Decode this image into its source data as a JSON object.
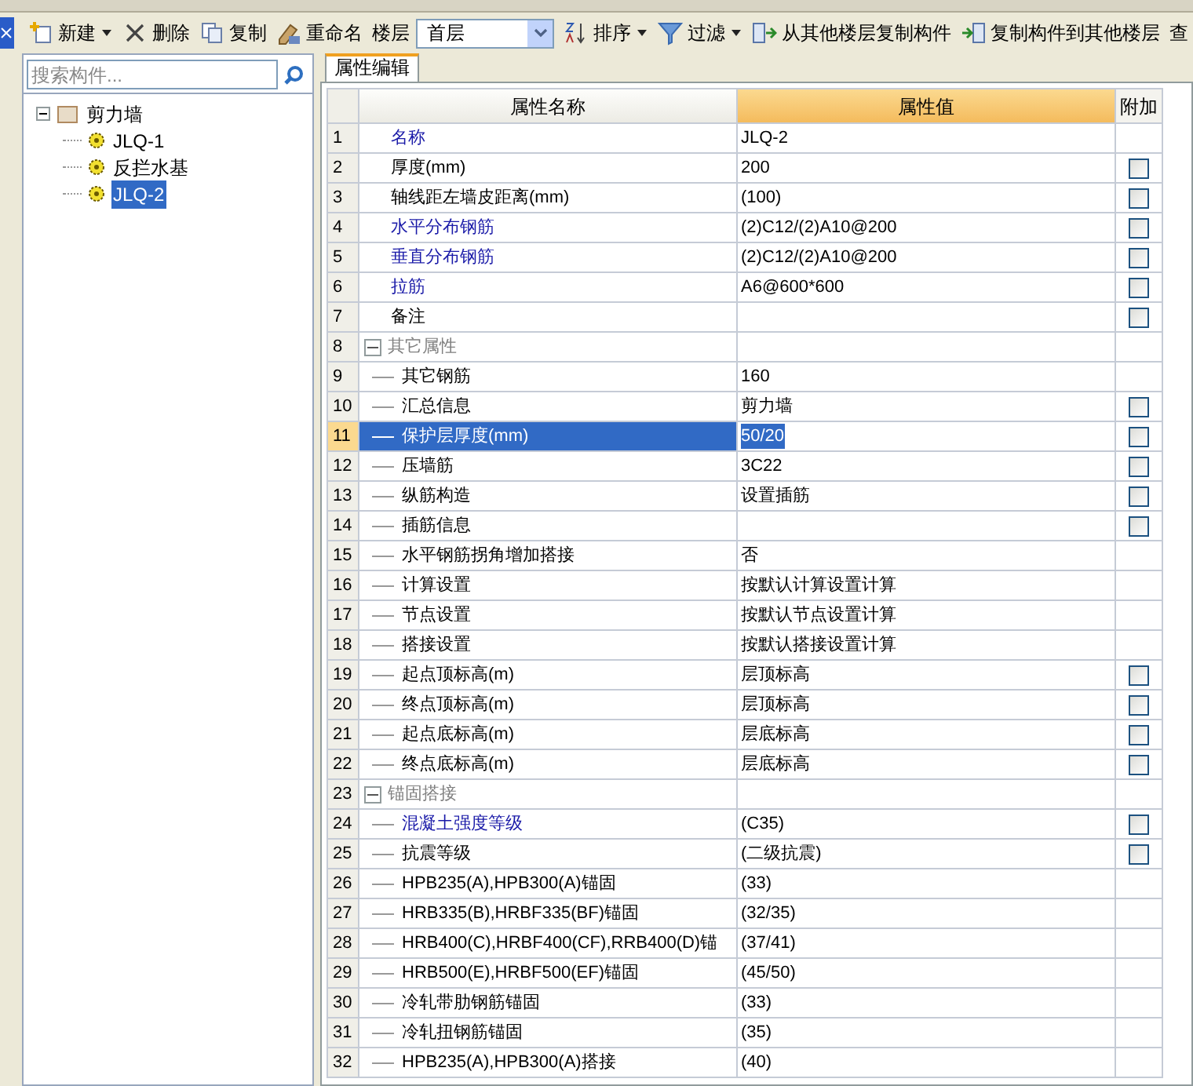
{
  "toolbar": [
    {
      "kind": "button",
      "label": "新建",
      "menu": true
    },
    {
      "kind": "button",
      "label": "删除",
      "menu": false
    },
    {
      "kind": "button",
      "label": "复制",
      "menu": false
    },
    {
      "kind": "button",
      "label": "重命名",
      "menu": false
    },
    {
      "kind": "floor",
      "label": "楼层",
      "value": "首层"
    },
    {
      "kind": "button",
      "label": "排序",
      "menu": true
    },
    {
      "kind": "button",
      "label": "过滤",
      "menu": true
    },
    {
      "kind": "button",
      "label": "从其他楼层复制构件",
      "menu": false
    },
    {
      "kind": "button",
      "label": "复制构件到其他楼层",
      "menu": false
    },
    {
      "kind": "button",
      "label": "查",
      "menu": false
    }
  ],
  "search": {
    "placeholder": "搜索构件..."
  },
  "tree": [
    {
      "label": "剪力墙",
      "expanded": true,
      "selected": false,
      "children": [
        {
          "label": "JLQ-1",
          "selected": false
        },
        {
          "label": "反拦水基",
          "selected": false
        },
        {
          "label": "JLQ-2",
          "selected": true
        }
      ]
    }
  ],
  "tab": {
    "label": "属性编辑",
    "selected": true
  },
  "table": {
    "columns": [
      "属性名称",
      "属性值",
      "附加"
    ],
    "rows": [
      {
        "no": "1",
        "kind": "top",
        "name": "名称",
        "blue": true,
        "value": "JLQ-2",
        "selected": false
      },
      {
        "no": "2",
        "kind": "top",
        "name": "厚度(mm)",
        "blue": false,
        "value": "200",
        "checked": false,
        "selected": false
      },
      {
        "no": "3",
        "kind": "top",
        "name": "轴线距左墙皮距离(mm)",
        "blue": false,
        "value": "(100)",
        "checked": false,
        "selected": false
      },
      {
        "no": "4",
        "kind": "top",
        "name": "水平分布钢筋",
        "blue": true,
        "value": "(2)C12/(2)A10@200",
        "checked": false,
        "selected": false
      },
      {
        "no": "5",
        "kind": "top",
        "name": "垂直分布钢筋",
        "blue": true,
        "value": "(2)C12/(2)A10@200",
        "checked": false,
        "selected": false
      },
      {
        "no": "6",
        "kind": "top",
        "name": "拉筋",
        "blue": true,
        "value": "A6@600*600",
        "checked": false,
        "selected": false
      },
      {
        "no": "7",
        "kind": "top",
        "name": "备注",
        "blue": false,
        "value": "",
        "checked": false,
        "selected": false
      },
      {
        "no": "8",
        "kind": "group",
        "name": "其它属性",
        "expanded": true,
        "selected": false
      },
      {
        "no": "9",
        "kind": "child",
        "name": "其它钢筋",
        "blue": false,
        "value": "160",
        "selected": false
      },
      {
        "no": "10",
        "kind": "child",
        "name": "汇总信息",
        "blue": false,
        "value": "剪力墙",
        "checked": false,
        "selected": false
      },
      {
        "no": "11",
        "kind": "child",
        "name": "保护层厚度(mm)",
        "value": "50/20",
        "checked": false,
        "selected": true
      },
      {
        "no": "12",
        "kind": "child",
        "name": "压墙筋",
        "blue": false,
        "value": "3C22",
        "checked": false,
        "selected": false
      },
      {
        "no": "13",
        "kind": "child",
        "name": "纵筋构造",
        "blue": false,
        "value": "设置插筋",
        "checked": false,
        "selected": false
      },
      {
        "no": "14",
        "kind": "child",
        "name": "插筋信息",
        "blue": false,
        "value": "",
        "checked": false,
        "selected": false
      },
      {
        "no": "15",
        "kind": "child",
        "name": "水平钢筋拐角增加搭接",
        "blue": false,
        "value": "否",
        "selected": false
      },
      {
        "no": "16",
        "kind": "child",
        "name": "计算设置",
        "blue": false,
        "value": "按默认计算设置计算",
        "selected": false
      },
      {
        "no": "17",
        "kind": "child",
        "name": "节点设置",
        "blue": false,
        "value": "按默认节点设置计算",
        "selected": false
      },
      {
        "no": "18",
        "kind": "child",
        "name": "搭接设置",
        "blue": false,
        "value": "按默认搭接设置计算",
        "selected": false
      },
      {
        "no": "19",
        "kind": "child",
        "name": "起点顶标高(m)",
        "blue": false,
        "value": "层顶标高",
        "checked": false,
        "selected": false
      },
      {
        "no": "20",
        "kind": "child",
        "name": "终点顶标高(m)",
        "blue": false,
        "value": "层顶标高",
        "checked": false,
        "selected": false
      },
      {
        "no": "21",
        "kind": "child",
        "name": "起点底标高(m)",
        "blue": false,
        "value": "层底标高",
        "checked": false,
        "selected": false
      },
      {
        "no": "22",
        "kind": "child",
        "name": "终点底标高(m)",
        "blue": false,
        "value": "层底标高",
        "checked": false,
        "selected": false
      },
      {
        "no": "23",
        "kind": "group",
        "name": "锚固搭接",
        "expanded": true,
        "selected": false
      },
      {
        "no": "24",
        "kind": "child",
        "name": "混凝土强度等级",
        "blue": true,
        "value": "(C35)",
        "checked": false,
        "selected": false
      },
      {
        "no": "25",
        "kind": "child",
        "name": "抗震等级",
        "blue": false,
        "value": "(二级抗震)",
        "checked": false,
        "selected": false
      },
      {
        "no": "26",
        "kind": "child",
        "name": "HPB235(A),HPB300(A)锚固",
        "blue": false,
        "value": "(33)",
        "selected": false
      },
      {
        "no": "27",
        "kind": "child",
        "name": "HRB335(B),HRBF335(BF)锚固",
        "blue": false,
        "value": "(32/35)",
        "selected": false
      },
      {
        "no": "28",
        "kind": "child",
        "name": "HRB400(C),HRBF400(CF),RRB400(D)锚",
        "blue": false,
        "value": "(37/41)",
        "selected": false
      },
      {
        "no": "29",
        "kind": "child",
        "name": "HRB500(E),HRBF500(EF)锚固",
        "blue": false,
        "value": "(45/50)",
        "selected": false
      },
      {
        "no": "30",
        "kind": "child",
        "name": "冷轧带肋钢筋锚固",
        "blue": false,
        "value": "(33)",
        "selected": false
      },
      {
        "no": "31",
        "kind": "child",
        "name": "冷轧扭钢筋锚固",
        "blue": false,
        "value": "(35)",
        "selected": false
      },
      {
        "no": "32",
        "kind": "child",
        "name": "HPB235(A),HPB300(A)搭接",
        "blue": false,
        "value": "(40)",
        "selected": false
      }
    ]
  }
}
